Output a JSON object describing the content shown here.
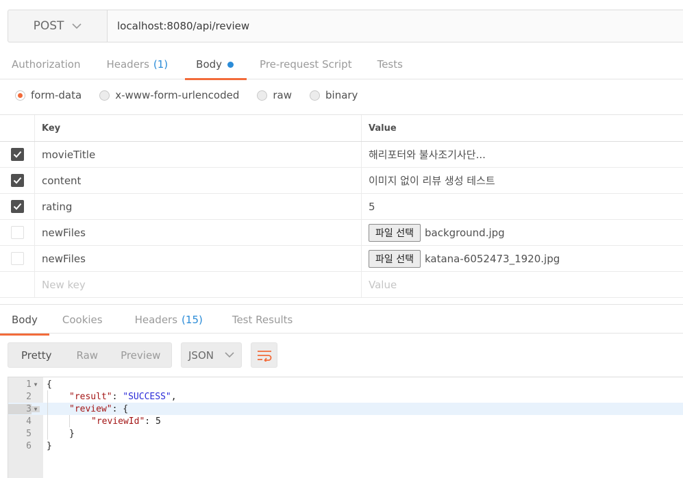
{
  "request": {
    "method": "POST",
    "url": "localhost:8080/api/review"
  },
  "req_tabs": {
    "authorization": "Authorization",
    "headers": "Headers",
    "headers_count": "(1)",
    "body": "Body",
    "prerequest": "Pre-request Script",
    "tests": "Tests"
  },
  "body_types": {
    "form_data": "form-data",
    "urlencoded": "x-www-form-urlencoded",
    "raw": "raw",
    "binary": "binary"
  },
  "params": {
    "key_header": "Key",
    "value_header": "Value",
    "rows": [
      {
        "key": "movieTitle",
        "value": "해리포터와 불사조기사단...",
        "checked": true
      },
      {
        "key": "content",
        "value": "이미지 없이 리뷰 생성 테스트",
        "checked": true
      },
      {
        "key": "rating",
        "value": "5",
        "checked": true
      },
      {
        "key": "newFiles",
        "file_button": "파일 선택",
        "file_name": "background.jpg",
        "checked": false
      },
      {
        "key": "newFiles",
        "file_button": "파일 선택",
        "file_name": "katana-6052473_1920.jpg",
        "checked": false
      }
    ],
    "new_key_placeholder": "New key",
    "new_value_placeholder": "Value"
  },
  "resp_tabs": {
    "body": "Body",
    "cookies": "Cookies",
    "headers": "Headers",
    "headers_count": "(15)",
    "test_results": "Test Results"
  },
  "resp_toolbar": {
    "pretty": "Pretty",
    "raw": "Raw",
    "preview": "Preview",
    "format": "JSON"
  },
  "editor": {
    "line_numbers": [
      "1",
      "2",
      "3",
      "4",
      "5",
      "6"
    ],
    "lines": {
      "l1": "{",
      "l2_key": "\"result\"",
      "l2_sep": ": ",
      "l2_val": "\"SUCCESS\"",
      "l2_end": ",",
      "l3_key": "\"review\"",
      "l3_rest": ": {",
      "l4_key": "\"reviewId\"",
      "l4_sep": ": ",
      "l4_val": "5",
      "l5": "}",
      "l6": "}"
    }
  },
  "colors": {
    "accent": "#f26b3a",
    "link_blue": "#2b8cd8"
  }
}
